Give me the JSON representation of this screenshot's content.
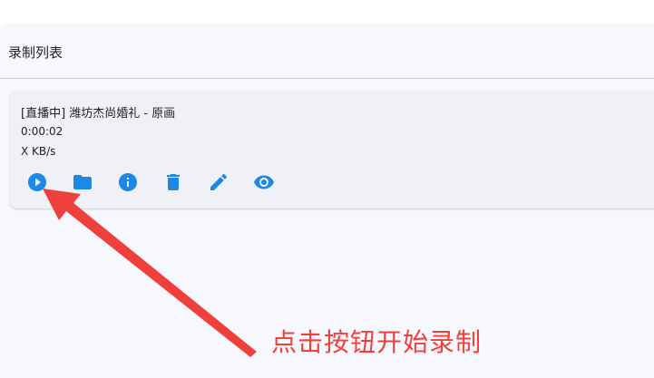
{
  "list": {
    "title": "录制列表"
  },
  "recording": {
    "title": "[直播中] 潍坊杰尚婚礼 - 原画",
    "duration": "0:00:02",
    "speed": "X KB/s"
  },
  "actions": [
    {
      "icon": "play-circle-icon"
    },
    {
      "icon": "folder-icon"
    },
    {
      "icon": "info-icon"
    },
    {
      "icon": "delete-icon"
    },
    {
      "icon": "edit-icon"
    },
    {
      "icon": "visibility-icon"
    }
  ],
  "annotation": {
    "text": "点击按钮开始录制",
    "color": "#f0403b"
  },
  "colors": {
    "accent": "#1e88e5",
    "card_bg": "#f0f1f6",
    "panel_bg": "#f7f8fd"
  }
}
